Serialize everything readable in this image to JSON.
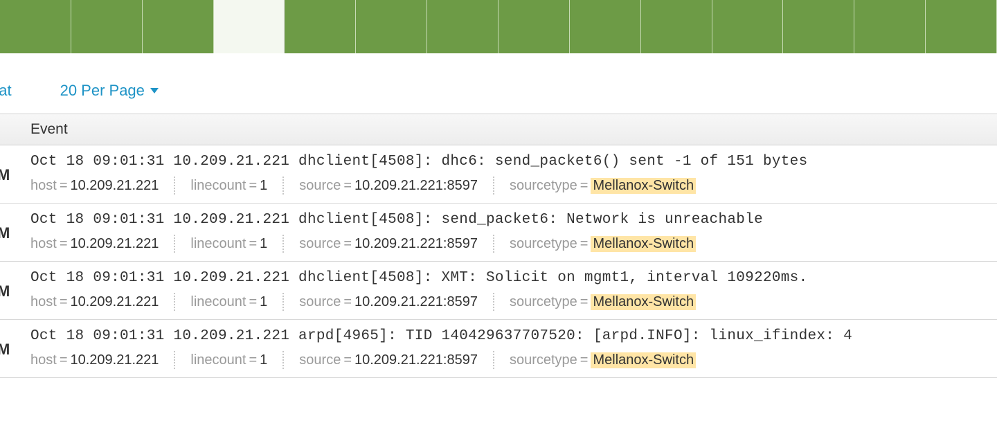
{
  "timeline": {
    "cells": 14,
    "selected_index": 3
  },
  "controls": {
    "format_label_fragment": "nat",
    "per_page_label": "20 Per Page"
  },
  "table": {
    "header_event": "Event"
  },
  "time_stub": "M",
  "events": [
    {
      "raw": "Oct 18 09:01:31 10.209.21.221 dhclient[4508]: dhc6: send_packet6() sent -1 of 151 bytes",
      "host": "10.209.21.221",
      "linecount": "1",
      "source": "10.209.21.221:8597",
      "sourcetype": "Mellanox-Switch"
    },
    {
      "raw": "Oct 18 09:01:31 10.209.21.221 dhclient[4508]: send_packet6: Network is unreachable",
      "host": "10.209.21.221",
      "linecount": "1",
      "source": "10.209.21.221:8597",
      "sourcetype": "Mellanox-Switch"
    },
    {
      "raw": "Oct 18 09:01:31 10.209.21.221 dhclient[4508]: XMT: Solicit on mgmt1, interval 109220ms.",
      "host": "10.209.21.221",
      "linecount": "1",
      "source": "10.209.21.221:8597",
      "sourcetype": "Mellanox-Switch"
    },
    {
      "raw": "Oct 18 09:01:31 10.209.21.221 arpd[4965]: TID 140429637707520: [arpd.INFO]: linux_ifindex: 4",
      "host": "10.209.21.221",
      "linecount": "1",
      "source": "10.209.21.221:8597",
      "sourcetype": "Mellanox-Switch"
    }
  ],
  "meta_labels": {
    "host": "host",
    "linecount": "linecount",
    "source": "source",
    "sourcetype": "sourcetype"
  }
}
